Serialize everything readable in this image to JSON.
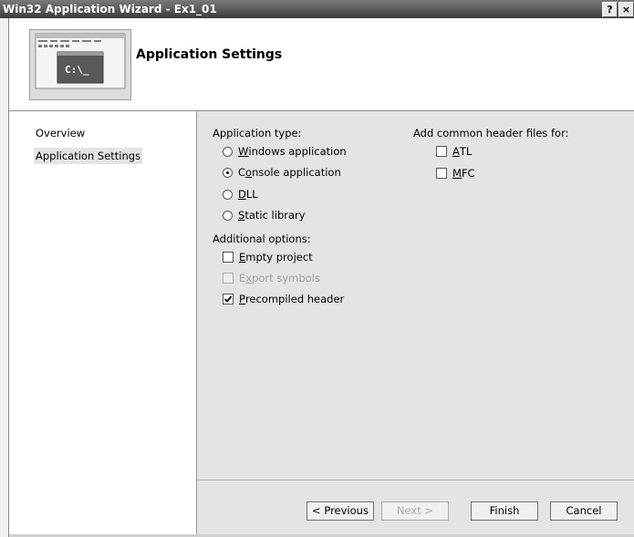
{
  "window": {
    "title": "Win32 Application Wizard - Ex1_01",
    "help_label": "?",
    "close_label": "×"
  },
  "header": {
    "title": "Application Settings",
    "image_icon": "console-window-icon",
    "image_text": "C:\\_"
  },
  "nav": {
    "items": [
      {
        "label": "Overview",
        "selected": false
      },
      {
        "label": "Application Settings",
        "selected": true
      }
    ]
  },
  "app_type": {
    "label": "Application type:",
    "options": [
      {
        "pre": "",
        "key": "W",
        "post": "indows application",
        "selected": false
      },
      {
        "pre": "C",
        "key": "o",
        "post": "nsole application",
        "selected": true
      },
      {
        "pre": "",
        "key": "D",
        "post": "LL",
        "selected": false
      },
      {
        "pre": "",
        "key": "S",
        "post": "tatic library",
        "selected": false
      }
    ]
  },
  "additional": {
    "label": "Additional options:",
    "options": [
      {
        "pre": "",
        "key": "E",
        "post": "mpty project",
        "checked": false,
        "enabled": true
      },
      {
        "pre": "E",
        "key": "x",
        "post": "port symbols",
        "checked": false,
        "enabled": false
      },
      {
        "pre": "",
        "key": "P",
        "post": "recompiled header",
        "checked": true,
        "enabled": true
      }
    ]
  },
  "headers": {
    "label": "Add common header files for:",
    "options": [
      {
        "pre": "",
        "key": "A",
        "post": "TL",
        "checked": false
      },
      {
        "pre": "",
        "key": "M",
        "post": "FC",
        "checked": false
      }
    ]
  },
  "buttons": {
    "previous": "< Previous",
    "next": "Next >",
    "finish": "Finish",
    "cancel": "Cancel"
  },
  "colors": {
    "content_bg": "#e4e4e4",
    "titlebar": "#3c3c3c"
  }
}
